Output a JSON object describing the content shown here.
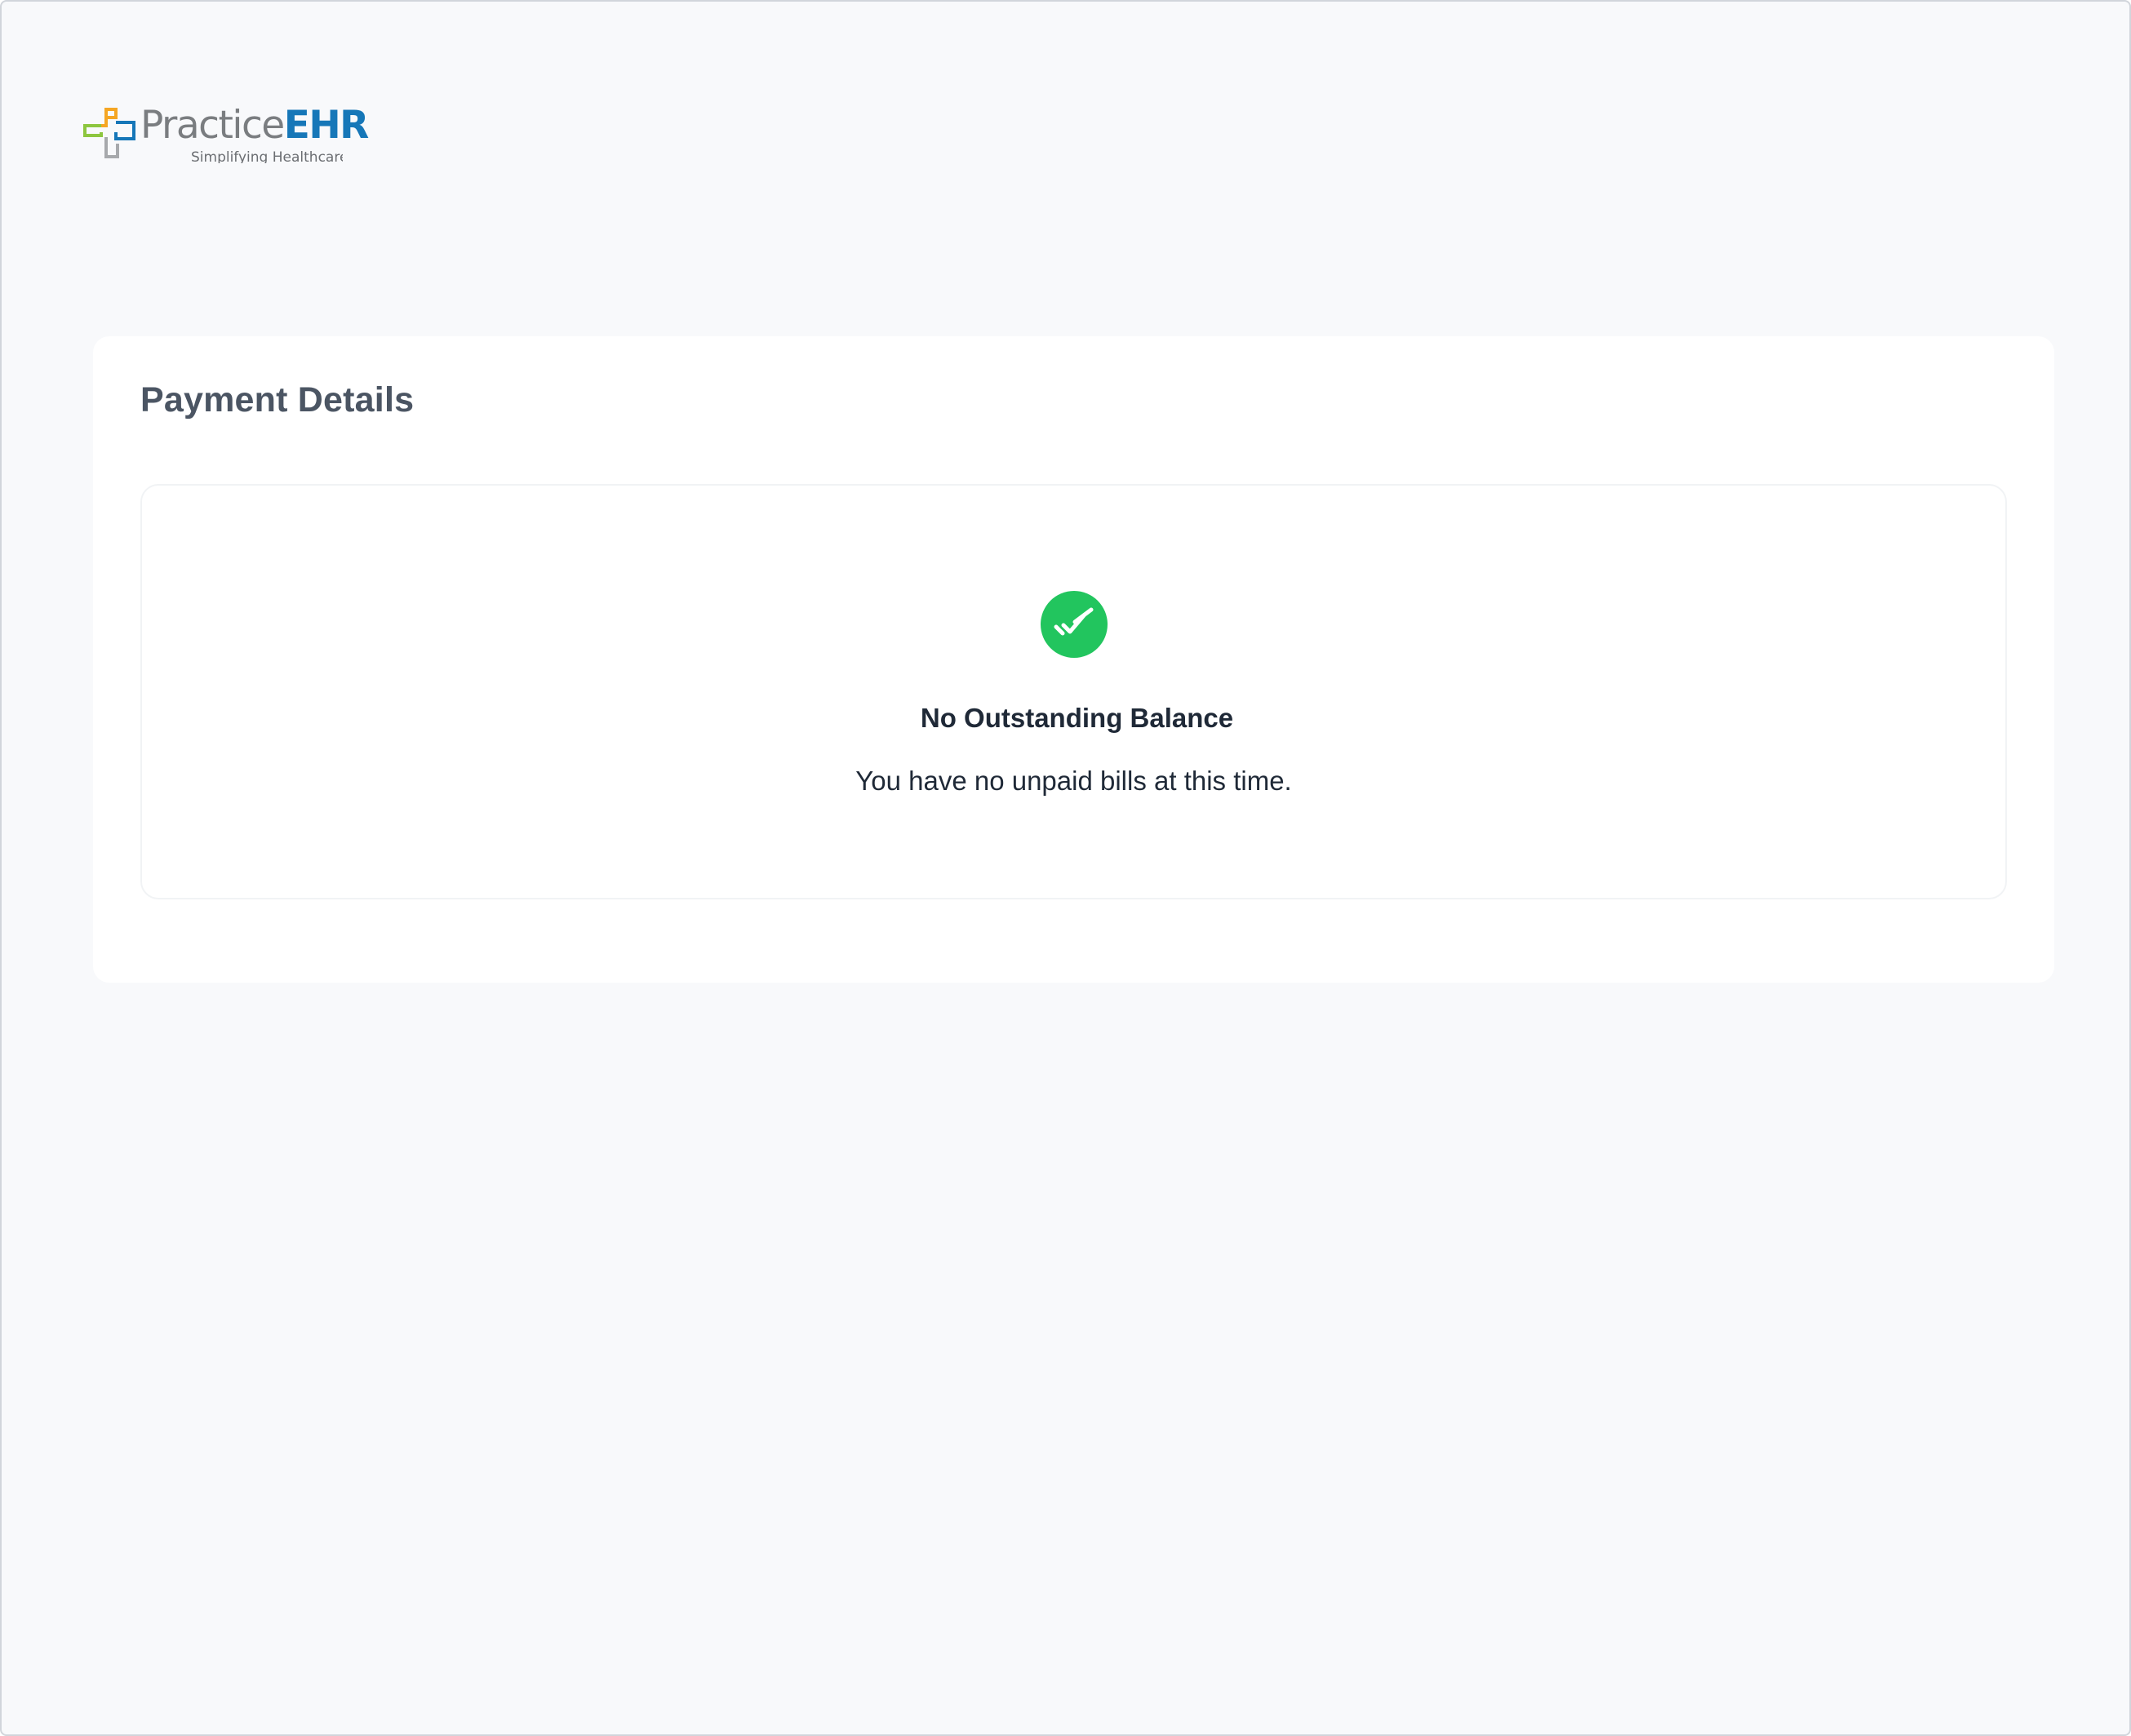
{
  "brand": {
    "name_part1": "Practice",
    "name_part2": "EHR",
    "tagline": "Simplifying Healthcare",
    "colors": {
      "practice_text": "#7a7d80",
      "ehr_text": "#1677b8",
      "cross_orange": "#f5a623",
      "cross_green": "#8dc63f",
      "cross_blue": "#1677b8",
      "cross_gray": "#a7a9ac"
    }
  },
  "payment_details": {
    "title": "Payment Details",
    "empty_state": {
      "icon": "double-check-icon",
      "icon_color": "#22c55e",
      "heading": "No Outstanding Balance",
      "message": "You have no unpaid bills at this time."
    }
  }
}
